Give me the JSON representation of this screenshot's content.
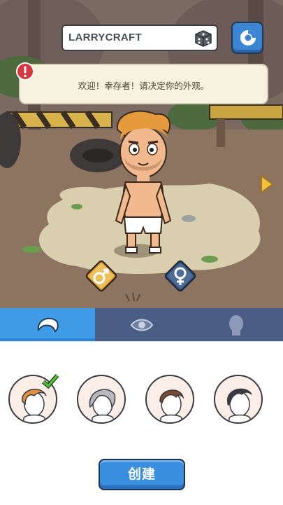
{
  "player": {
    "name": "LARRYCRAFT"
  },
  "notice": {
    "text": "欢迎！幸存者！请决定你的外观。"
  },
  "gender": {
    "male_symbol": "♂",
    "female_symbol": "♀",
    "selected": "male"
  },
  "tabs": [
    {
      "icon": "hair-icon",
      "active": true
    },
    {
      "icon": "eye-icon",
      "active": false
    },
    {
      "icon": "body-icon",
      "active": false
    }
  ],
  "hair_options": [
    {
      "icon": "hair-orange-icon",
      "selected": true
    },
    {
      "icon": "hair-gray-icon",
      "selected": false
    },
    {
      "icon": "hair-brown-icon",
      "selected": false
    },
    {
      "icon": "hair-black-icon",
      "selected": false
    }
  ],
  "actions": {
    "create_label": "创建"
  },
  "colors": {
    "accent": "#3a8fe0",
    "tab_active": "#3f9be6",
    "tab_bar": "#4a5d85",
    "ground": "#8c7360",
    "check": "#4fc13a"
  }
}
